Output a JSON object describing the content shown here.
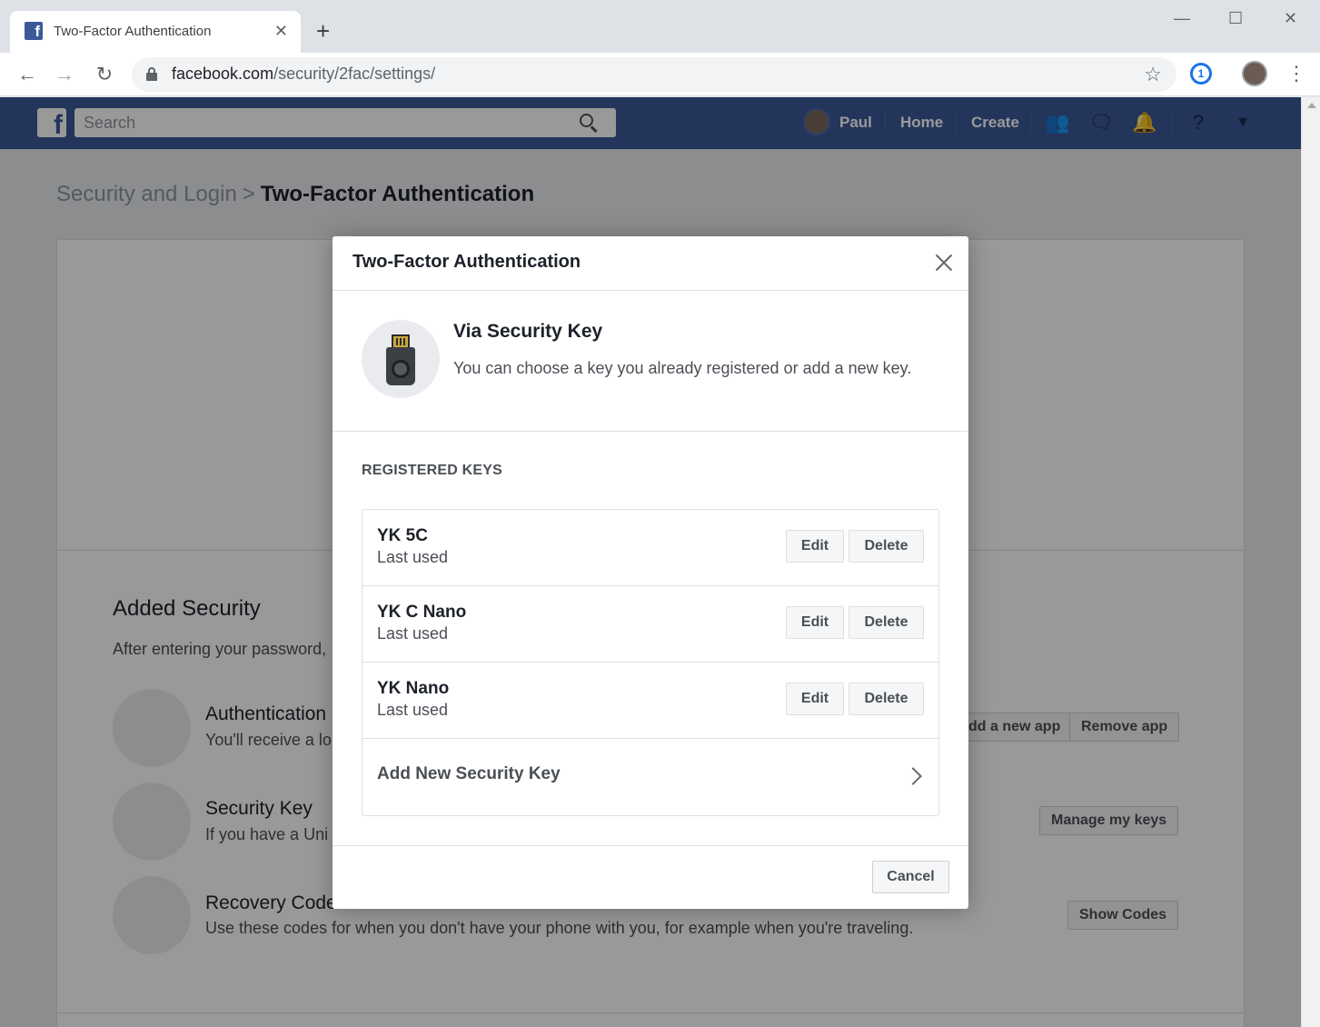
{
  "browser": {
    "tab_title": "Two-Factor Authentication",
    "favicon_letter": "f",
    "new_tab": "+",
    "url_host": "facebook.com",
    "url_path": "/security/2fac/settings/",
    "minimize": "—",
    "maximize": "☐",
    "close": "✕",
    "extension_label": "1"
  },
  "facebook": {
    "logo_letter": "f",
    "search_placeholder": "Search",
    "user_name": "Paul",
    "nav_home": "Home",
    "nav_create": "Create",
    "brand_color": "#3b5998"
  },
  "page": {
    "breadcrumb_parent": "Security and Login",
    "breadcrumb_sep": ">",
    "breadcrumb_current": "Two-Factor Authentication",
    "added_security_title": "Added Security",
    "added_security_desc": "After entering your password,",
    "rows": [
      {
        "title": "Authentication .",
        "desc": "You'll receive a lo",
        "icon": "qr-code-icon"
      },
      {
        "title": "Security Key",
        "desc": "If you have a Uni",
        "icon": "security-key-icon"
      },
      {
        "title": "Recovery Code",
        "desc": "Use these codes for when you don't have your phone with you, for example when you're traveling.",
        "icon": "document-icon"
      }
    ],
    "btn_add_app": "dd a new app",
    "btn_remove_app": "Remove app",
    "btn_manage_keys": "Manage my keys",
    "btn_show_codes": "Show Codes"
  },
  "dialog": {
    "title": "Two-Factor Authentication",
    "via_title": "Via Security Key",
    "via_desc": "You can choose a key you already registered or add a new key.",
    "registered_label": "REGISTERED KEYS",
    "keys": [
      {
        "name": "YK 5C",
        "sub": "Last used"
      },
      {
        "name": "YK C Nano",
        "sub": "Last used"
      },
      {
        "name": "YK Nano",
        "sub": "Last used"
      }
    ],
    "edit_label": "Edit",
    "delete_label": "Delete",
    "add_key_label": "Add New Security Key",
    "cancel_label": "Cancel"
  }
}
